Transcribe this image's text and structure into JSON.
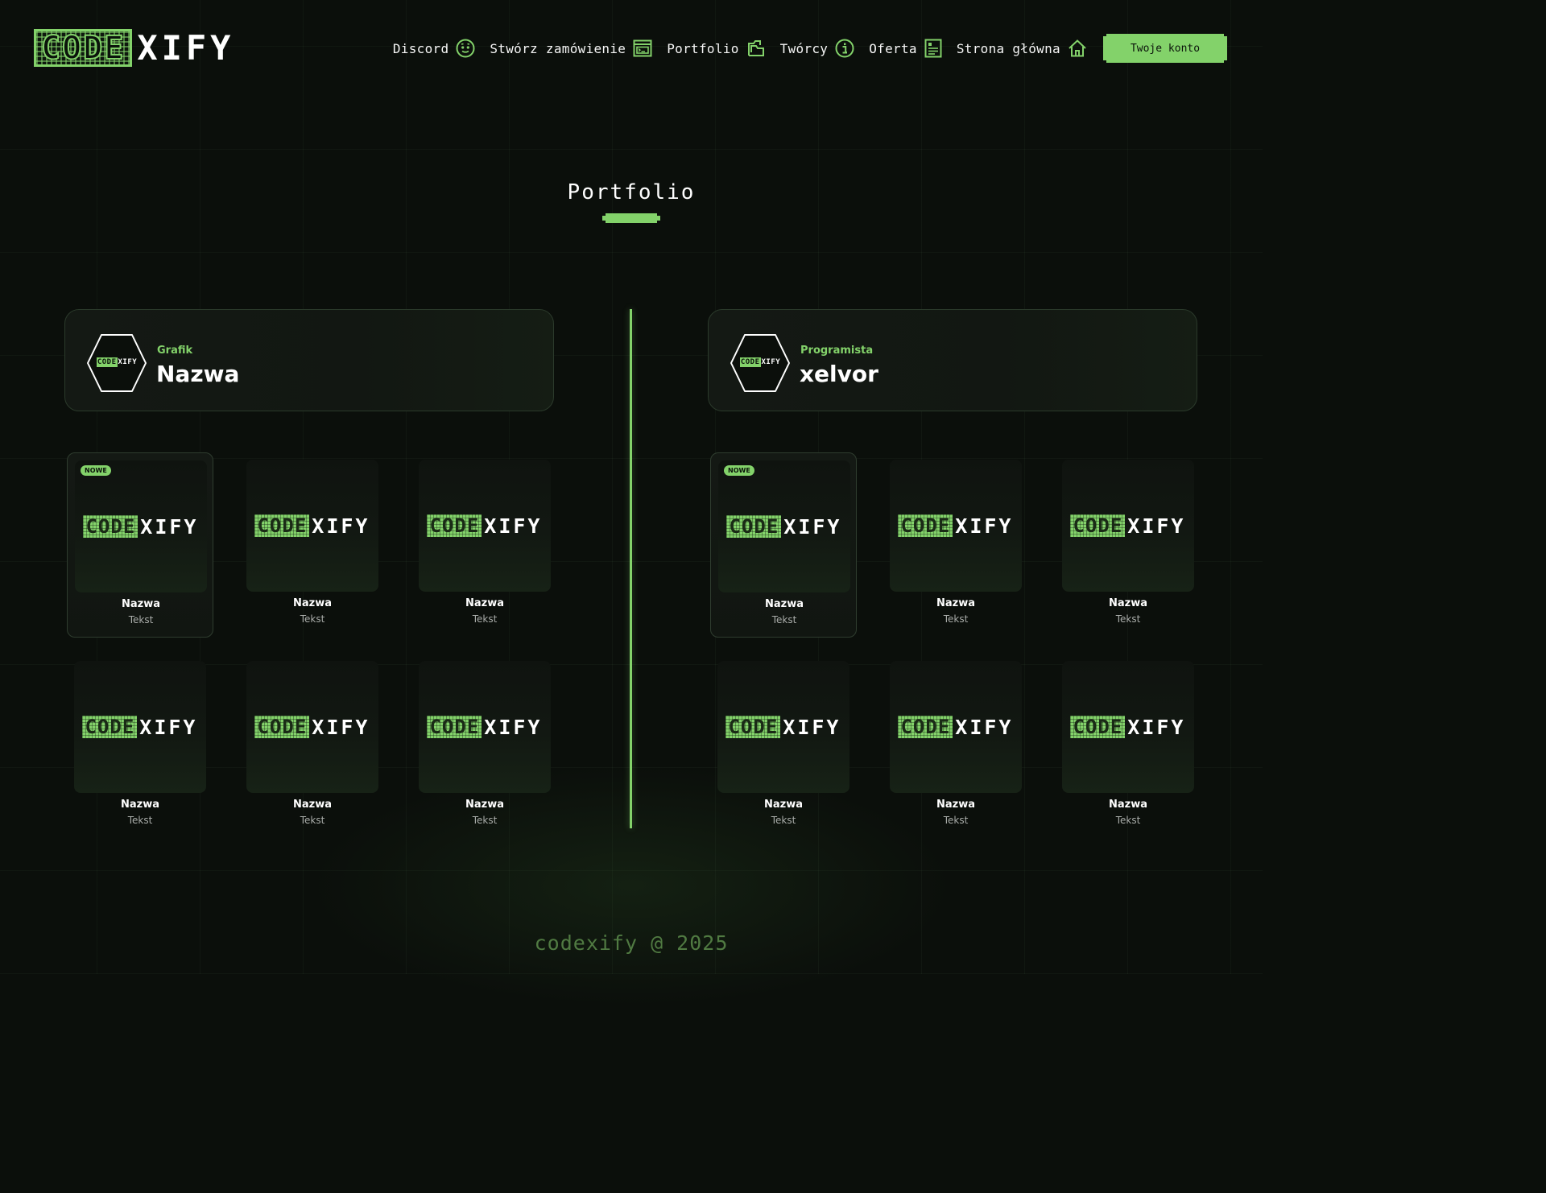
{
  "brand": {
    "logo_boxed": "CODE",
    "logo_rest": "XIFY"
  },
  "nav": [
    {
      "label": "Discord",
      "icon": "discord-icon"
    },
    {
      "label": "Stwórz zamówienie",
      "icon": "order-window-icon"
    },
    {
      "label": "Portfolio",
      "icon": "folder-icon"
    },
    {
      "label": "Twórcy",
      "icon": "info-icon"
    },
    {
      "label": "Oferta",
      "icon": "document-icon"
    },
    {
      "label": "Strona główna",
      "icon": "home-icon"
    }
  ],
  "account_button": "Twoje konto",
  "section": {
    "title": "Portfolio"
  },
  "creators": [
    {
      "role": "Grafik",
      "name": "Nazwa",
      "avatar_boxed": "CODE",
      "avatar_rest": "XIFY",
      "items": [
        {
          "badge": "NOWE",
          "name": "Nazwa",
          "text": "Tekst",
          "logo_boxed": "CODE",
          "logo_rest": "XIFY"
        },
        {
          "name": "Nazwa",
          "text": "Tekst",
          "logo_boxed": "CODE",
          "logo_rest": "XIFY"
        },
        {
          "name": "Nazwa",
          "text": "Tekst",
          "logo_boxed": "CODE",
          "logo_rest": "XIFY"
        },
        {
          "name": "Nazwa",
          "text": "Tekst",
          "logo_boxed": "CODE",
          "logo_rest": "XIFY"
        },
        {
          "name": "Nazwa",
          "text": "Tekst",
          "logo_boxed": "CODE",
          "logo_rest": "XIFY"
        },
        {
          "name": "Nazwa",
          "text": "Tekst",
          "logo_boxed": "CODE",
          "logo_rest": "XIFY"
        }
      ]
    },
    {
      "role": "Programista",
      "name": "xelvor",
      "avatar_boxed": "CODE",
      "avatar_rest": "XIFY",
      "items": [
        {
          "badge": "NOWE",
          "name": "Nazwa",
          "text": "Tekst",
          "logo_boxed": "CODE",
          "logo_rest": "XIFY"
        },
        {
          "name": "Nazwa",
          "text": "Tekst",
          "logo_boxed": "CODE",
          "logo_rest": "XIFY"
        },
        {
          "name": "Nazwa",
          "text": "Tekst",
          "logo_boxed": "CODE",
          "logo_rest": "XIFY"
        },
        {
          "name": "Nazwa",
          "text": "Tekst",
          "logo_boxed": "CODE",
          "logo_rest": "XIFY"
        },
        {
          "name": "Nazwa",
          "text": "Tekst",
          "logo_boxed": "CODE",
          "logo_rest": "XIFY"
        },
        {
          "name": "Nazwa",
          "text": "Tekst",
          "logo_boxed": "CODE",
          "logo_rest": "XIFY"
        }
      ]
    }
  ],
  "footer": "codexify @ 2025",
  "colors": {
    "accent": "#83d26a",
    "background": "#0b0f0b",
    "card": "#141914",
    "footer_text": "#507a42"
  }
}
